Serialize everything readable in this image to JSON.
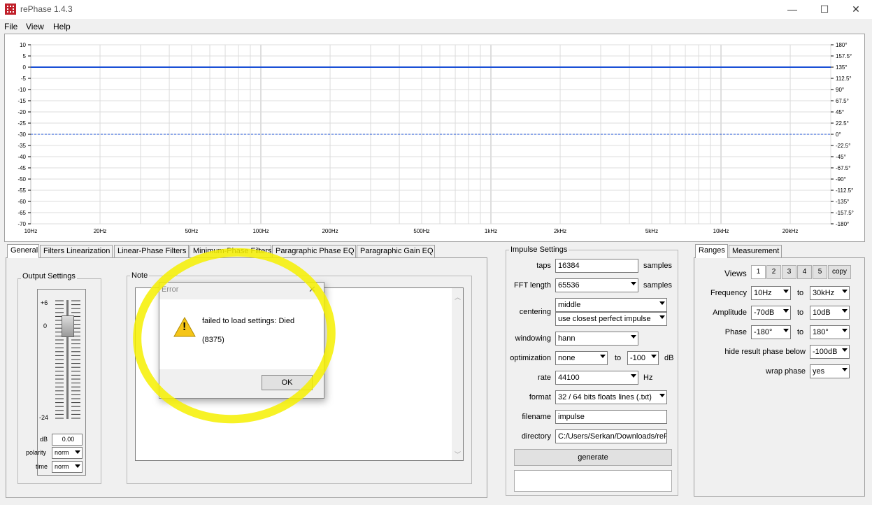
{
  "window": {
    "title": "rePhase 1.4.3",
    "min_glyph": "—",
    "max_glyph": "☐",
    "close_glyph": "✕"
  },
  "menu": [
    "File",
    "View",
    "Help"
  ],
  "graph": {
    "left_axis": [
      "10",
      "5",
      "0",
      "-5",
      "-10",
      "-15",
      "-20",
      "-25",
      "-30",
      "-35",
      "-40",
      "-45",
      "-50",
      "-55",
      "-60",
      "-65",
      "-70"
    ],
    "right_axis": [
      "180°",
      "157.5°",
      "135°",
      "112.5°",
      "90°",
      "67.5°",
      "45°",
      "22.5°",
      "0°",
      "-22.5°",
      "-45°",
      "-67.5°",
      "-90°",
      "-112.5°",
      "-135°",
      "-157.5°",
      "-180°"
    ],
    "freq_labels": [
      "10Hz",
      "20Hz",
      "50Hz",
      "100Hz",
      "200Hz",
      "500Hz",
      "1kHz",
      "2kHz",
      "5kHz",
      "10kHz",
      "20kHz"
    ],
    "amplitude_color": "#1a4fd6",
    "phase_color": "#1a4fd6"
  },
  "tabs": [
    "General",
    "Filters Linearization",
    "Linear-Phase Filters",
    "Minimum-Phase Filters",
    "Paragraphic Phase EQ",
    "Paragraphic Gain EQ"
  ],
  "output_settings": {
    "title": "Output Settings",
    "scale_top": "+6",
    "scale_zero": "0",
    "scale_bottom": "-24",
    "db_label": "dB",
    "db_value": "0.00",
    "polarity_label": "polarity",
    "polarity_value": "norm",
    "time_label": "time",
    "time_value": "norm"
  },
  "note": {
    "title": "Note"
  },
  "impulse": {
    "title": "Impulse Settings",
    "taps_label": "taps",
    "taps_value": "16384",
    "taps_unit": "samples",
    "fft_label": "FFT length",
    "fft_value": "65536",
    "fft_unit": "samples",
    "centering_label": "centering",
    "centering_value": "middle",
    "centering_value2": "use closest perfect impulse",
    "windowing_label": "windowing",
    "windowing_value": "hann",
    "optimization_label": "optimization",
    "optimization_value": "none",
    "optimization_to": "to",
    "optimization_to_value": "-100",
    "optimization_unit": "dB",
    "rate_label": "rate",
    "rate_value": "44100",
    "rate_unit": "Hz",
    "format_label": "format",
    "format_value": "32 / 64 bits floats lines (.txt)",
    "filename_label": "filename",
    "filename_value": "impulse",
    "directory_label": "directory",
    "directory_value": "C:/Users/Serkan/Downloads/reP",
    "generate_label": "generate"
  },
  "ranges": {
    "tabs": [
      "Ranges",
      "Measurement"
    ],
    "views_label": "Views",
    "views": [
      "1",
      "2",
      "3",
      "4",
      "5",
      "copy"
    ],
    "frequency_label": "Frequency",
    "frequency_from": "10Hz",
    "frequency_to": "30kHz",
    "amplitude_label": "Amplitude",
    "amplitude_from": "-70dB",
    "amplitude_to": "10dB",
    "phase_label": "Phase",
    "phase_from": "-180°",
    "phase_to": "180°",
    "to_label": "to",
    "hide_label": "hide result phase below",
    "hide_value": "-100dB",
    "wrap_label": "wrap phase",
    "wrap_value": "yes"
  },
  "dialog": {
    "title": "Error",
    "message": "failed to load settings: Died",
    "code": "(8375)",
    "ok_label": "OK",
    "close_glyph": "✕",
    "warning_glyph": "!"
  }
}
